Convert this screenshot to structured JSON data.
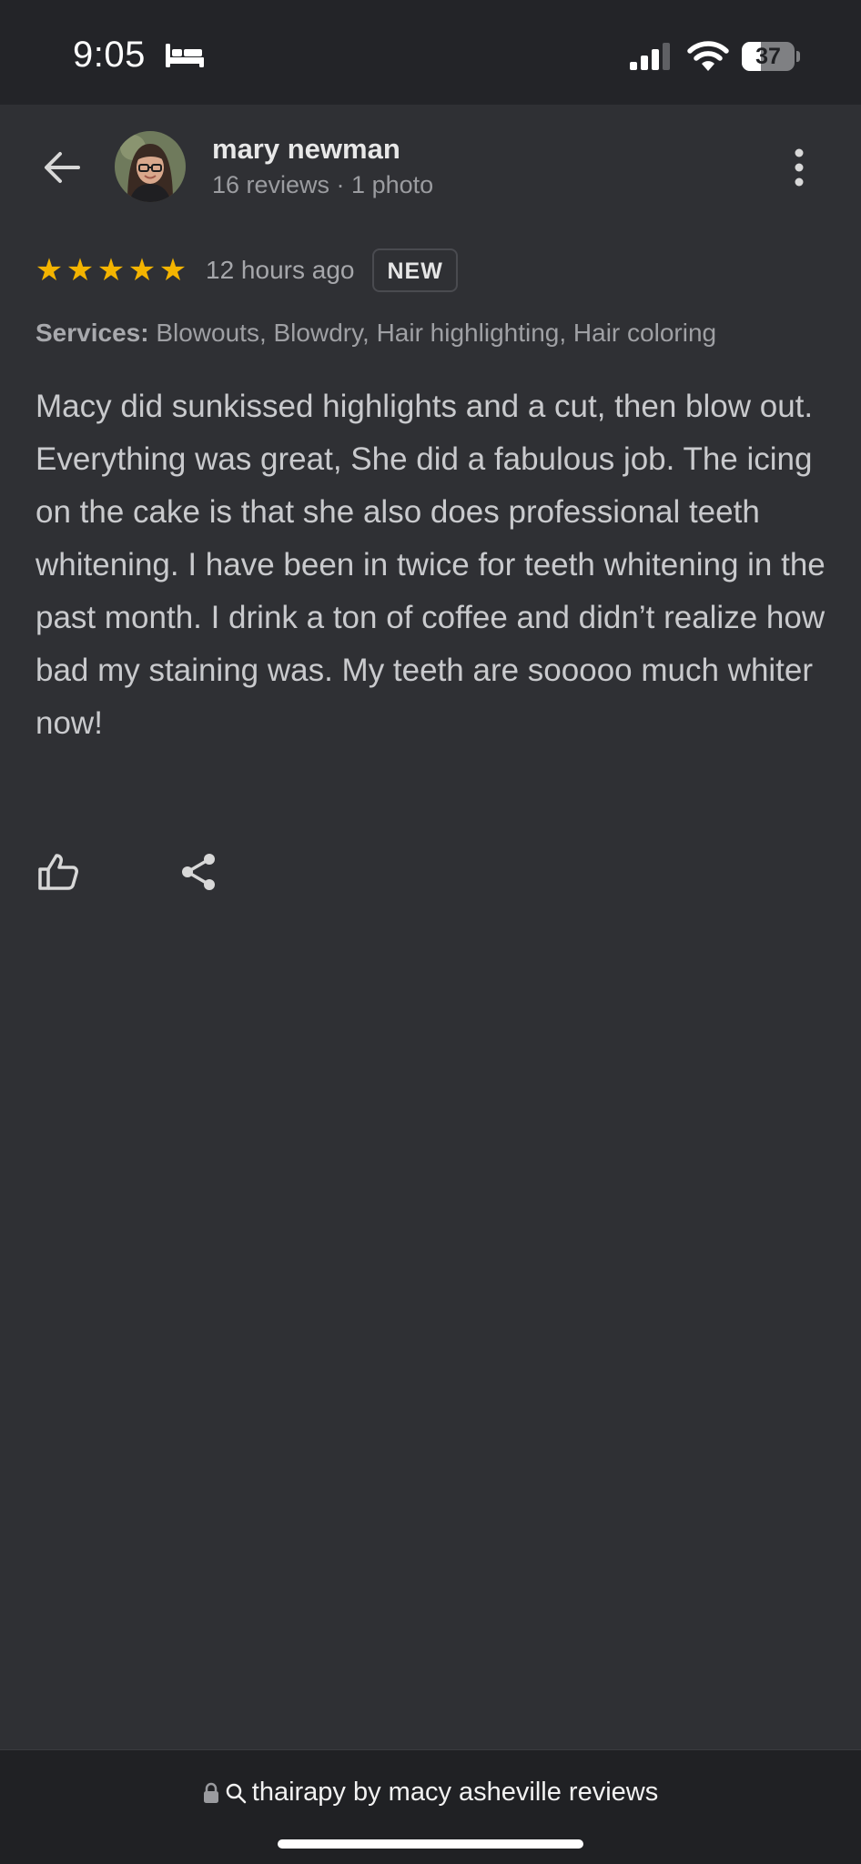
{
  "status_bar": {
    "time": "9:05",
    "battery_level": 37,
    "battery_label": "37",
    "sleep_icon": "bed-icon",
    "signal_icon": "cellular-signal-icon",
    "wifi_icon": "wifi-icon"
  },
  "header": {
    "back_icon": "arrow-left-icon",
    "user_name": "mary newman",
    "user_meta": "16 reviews · 1 photo",
    "more_icon": "more-vertical-icon"
  },
  "review": {
    "rating": 5,
    "stars": [
      "★",
      "★",
      "★",
      "★",
      "★"
    ],
    "time_ago": "12 hours ago",
    "badge": "NEW",
    "services_label": "Services:",
    "services_value": "Blowouts, Blowdry, Hair highlighting, Hair coloring",
    "text": "Macy did sunkissed highlights and a cut, then blow out. Everything was great, She did a fabulous job. The icing on the cake is that she also does professional teeth whitening. I have been in twice for teeth whitening in the past month. I drink a ton of coffee and didn’t realize how bad my staining was. My teeth are sooooo much whiter now!"
  },
  "actions": {
    "like_icon": "thumbs-up-icon",
    "share_icon": "share-icon"
  },
  "browser": {
    "url_text": "thairapy by macy asheville reviews",
    "lock_icon": "lock-icon",
    "search_icon": "search-icon"
  },
  "colors": {
    "background": "#2f3034",
    "status_bar": "#232428",
    "star": "#f4b400",
    "bottom_bar": "#202124"
  }
}
